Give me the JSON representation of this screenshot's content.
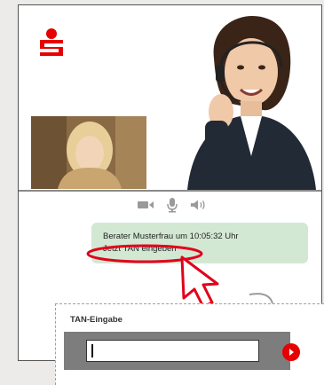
{
  "brand": {
    "logo_icon": "sparkasse-logo-icon",
    "color": "#e60000"
  },
  "toolbar": {
    "icons": [
      "video-camera-icon",
      "microphone-icon",
      "speaker-icon"
    ],
    "color": "#9a9a9a"
  },
  "chat": {
    "message_line1": "Berater Musterfrau um 10:05:32 Uhr",
    "message_line2": "Jetzt TAN eingeben",
    "bubble_color": "#d3e8d3"
  },
  "tan": {
    "title": "TAN-Eingabe",
    "input_value": "",
    "submit_icon": "chevron-right-icon"
  },
  "annotations": {
    "color": "#e2001a"
  }
}
